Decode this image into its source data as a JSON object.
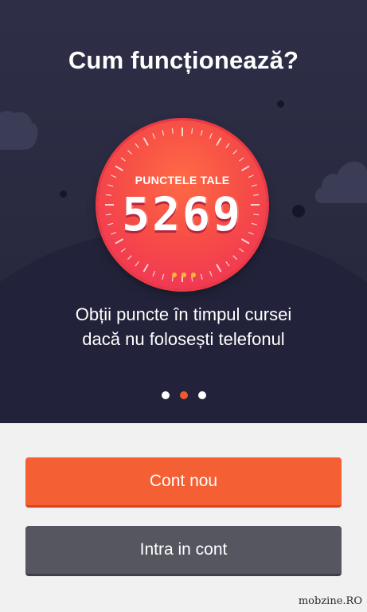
{
  "header": {
    "title": "Cum funcționează?"
  },
  "gauge": {
    "label": "PUNCTELE TALE",
    "value": "5269"
  },
  "description": {
    "line1": "Obții puncte în timpul cursei",
    "line2": "dacă nu folosești telefonul"
  },
  "pager": {
    "pages": 3,
    "active_index": 1
  },
  "buttons": {
    "new_account": "Cont nou",
    "login": "Intra in cont"
  },
  "watermark": "mobzine.RO",
  "colors": {
    "background_dark": "#2b2c44",
    "accent": "#f45f33",
    "secondary_button": "#555660",
    "gauge_dots": "#ffb43a"
  }
}
